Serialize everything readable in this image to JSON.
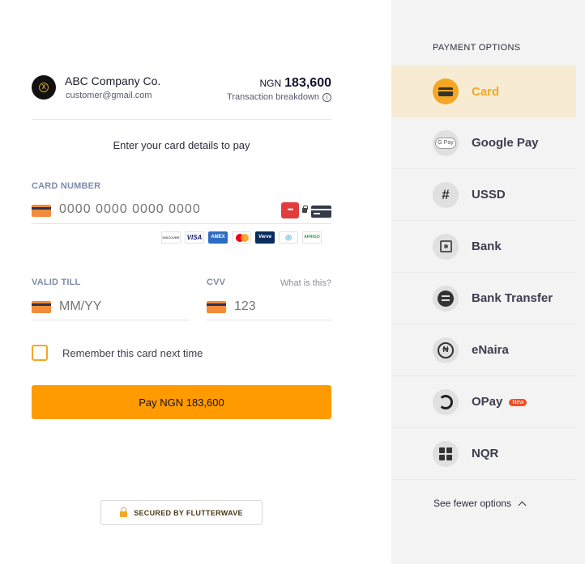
{
  "merchant": {
    "name": "ABC Company Co.",
    "email": "customer@gmail.com",
    "currency": "NGN",
    "amount": "183,600",
    "breakdown_label": "Transaction breakdown"
  },
  "form": {
    "instruction": "Enter your card details to pay",
    "card_number_label": "CARD NUMBER",
    "card_number_placeholder": "0000 0000 0000 0000",
    "valid_till_label": "VALID TILL",
    "valid_till_placeholder": "MM/YY",
    "cvv_label": "CVV",
    "cvv_placeholder": "123",
    "cvv_help": "What is this?",
    "remember_label": "Remember this card next time",
    "pay_button": "Pay NGN 183,600",
    "secured_label": "SECURED BY FLUTTERWAVE",
    "brands": [
      "DISCOVER",
      "VISA",
      "AMEX",
      "",
      "Verve",
      "◎",
      "AFRIGO"
    ]
  },
  "sidebar": {
    "heading": "PAYMENT OPTIONS",
    "options": [
      {
        "label": "Card",
        "icon": "card-icon",
        "active": true
      },
      {
        "label": "Google Pay",
        "icon": "google-pay-icon"
      },
      {
        "label": "USSD",
        "icon": "hash-icon"
      },
      {
        "label": "Bank",
        "icon": "bank-icon"
      },
      {
        "label": "Bank Transfer",
        "icon": "bank-transfer-icon"
      },
      {
        "label": "eNaira",
        "icon": "enaira-icon"
      },
      {
        "label": "OPay",
        "icon": "opay-icon",
        "badge": "New"
      },
      {
        "label": "NQR",
        "icon": "qr-icon"
      }
    ],
    "see_fewer": "See fewer options"
  },
  "colors": {
    "accent": "#ff9b00",
    "active_bg": "#f7ecd3",
    "sidebar_bg": "#f3f3f3",
    "badge": "#f04e23"
  }
}
